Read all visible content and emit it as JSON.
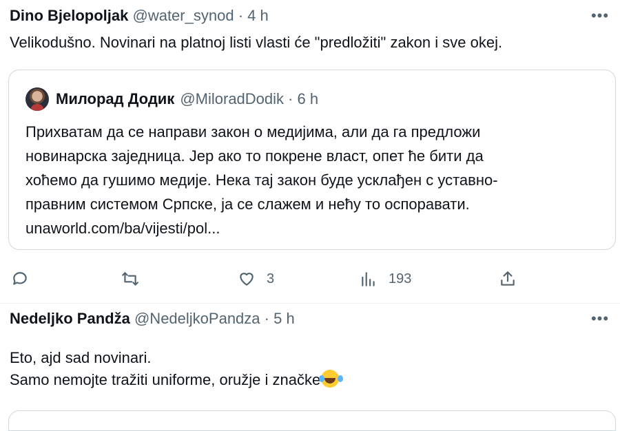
{
  "tweets": [
    {
      "author_name": "Dino Bjelopoljak",
      "handle": "@water_synod",
      "time": "· 4 h",
      "more_icon": "•••",
      "text": "Velikodušno. Novinari na platnoj listi vlasti će \"predložiti\" zakon i sve okej.",
      "quote": {
        "author_name": "Милорад Додик",
        "handle": "@MiloradDodik",
        "time": "· 6 h",
        "lines": [
          "Прихватам да се направи закон о медијима, али да га предложи",
          "новинарска заједница. Јер ако то покрене власт, опет ће бити да",
          "хоћемо да гушимо медије. Нека тај закон буде усклађен с уставно-",
          "правним системом Српске, ја се слажем и нећу то оспоравати."
        ],
        "link": "unaworld.com/ba/vijesti/pol..."
      },
      "actions": {
        "reply": {
          "icon": "reply-icon",
          "count": ""
        },
        "retweet": {
          "icon": "retweet-icon",
          "count": ""
        },
        "like": {
          "icon": "heart-icon",
          "count": "3"
        },
        "views": {
          "icon": "views-icon",
          "count": "193"
        },
        "share": {
          "icon": "share-icon"
        }
      }
    },
    {
      "author_name": "Nedeljko Pandža",
      "handle": "@NedeljkoPandza",
      "time": "· 5 h",
      "more_icon": "•••",
      "lines": [
        "Eto, ajd sad novinari.",
        "Samo nemojte tražiti uniforme, oružje i značke"
      ],
      "emoji": "face-with-tears-of-joy"
    }
  ],
  "colors": {
    "text": "#0f1419",
    "muted": "#536471",
    "border": "#cfd9de"
  }
}
